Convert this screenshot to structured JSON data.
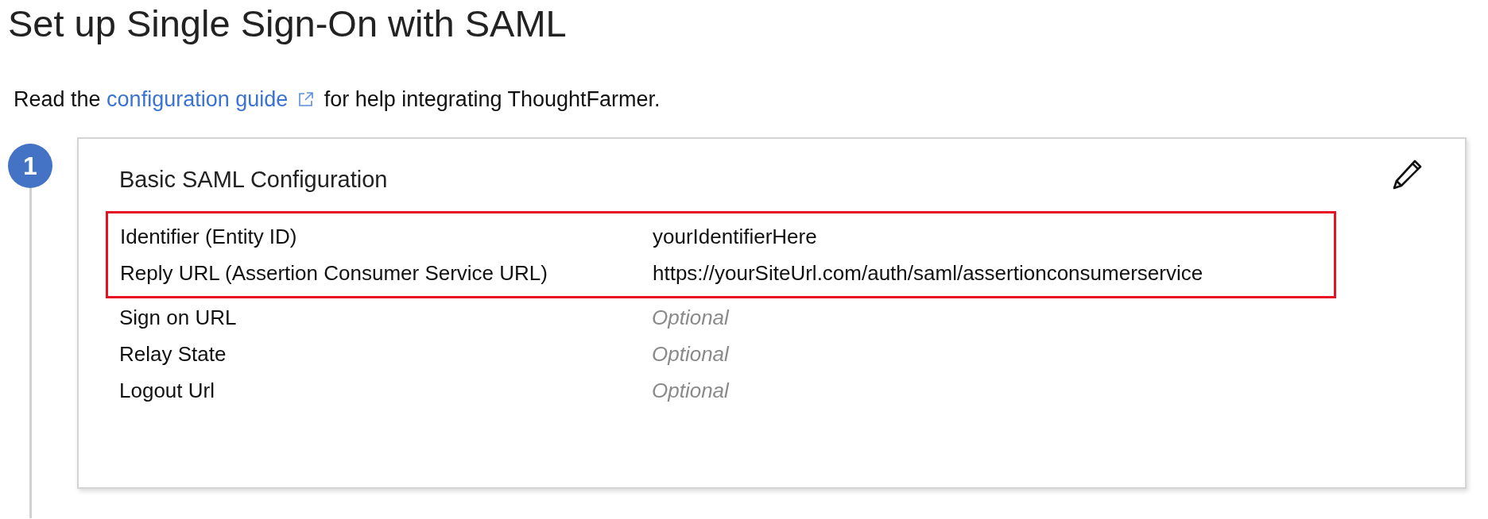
{
  "title": "Set up Single Sign-On with SAML",
  "intro": {
    "before": "Read the ",
    "link": "configuration guide",
    "after": " for help integrating ThoughtFarmer."
  },
  "steps": [
    {
      "number": "1",
      "card": {
        "title": "Basic SAML Configuration",
        "editable": true,
        "rows": [
          {
            "label": "Identifier (Entity ID)",
            "value": "yourIdentifierHere",
            "kind": "value",
            "highlighted": true
          },
          {
            "label": "Reply URL (Assertion Consumer Service URL)",
            "value": "https://yourSiteUrl.com/auth/saml/assertionconsumerservice",
            "kind": "value",
            "highlighted": true
          },
          {
            "label": "Sign on URL",
            "value": "Optional",
            "kind": "placeholder",
            "highlighted": false
          },
          {
            "label": "Relay State",
            "value": "Optional",
            "kind": "placeholder",
            "highlighted": false
          },
          {
            "label": "Logout Url",
            "value": "Optional",
            "kind": "placeholder",
            "highlighted": false
          }
        ]
      }
    }
  ]
}
